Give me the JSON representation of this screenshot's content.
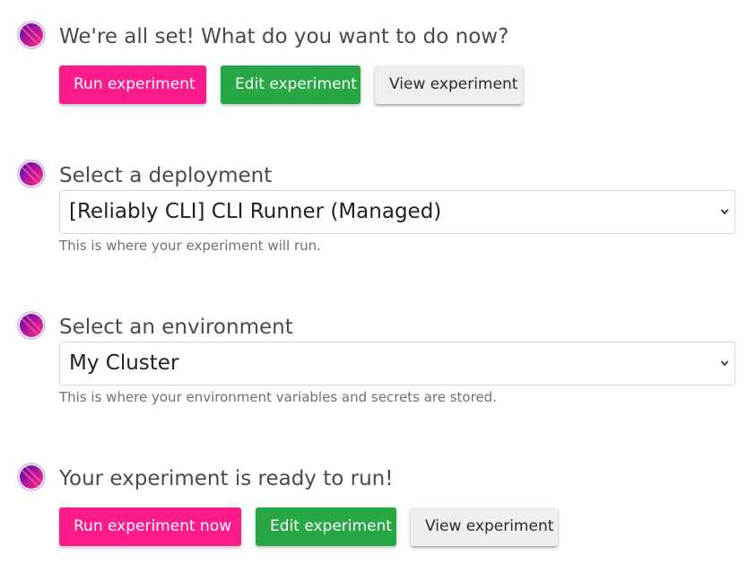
{
  "colors": {
    "accent_pink": "#fb1b8d",
    "accent_green": "#28a745",
    "neutral_button": "#efeff1"
  },
  "step1": {
    "avatar_icon": "reliably-logo-icon",
    "heading": "We're all set! What do you want to do now?",
    "run_label": "Run experiment",
    "edit_label": "Edit experiment",
    "view_label": "View experiment"
  },
  "step2": {
    "avatar_icon": "reliably-logo-icon",
    "heading": "Select a deployment",
    "selected": "[Reliably CLI] CLI Runner (Managed)",
    "help": "This is where your experiment will run."
  },
  "step3": {
    "avatar_icon": "reliably-logo-icon",
    "heading": "Select an environment",
    "selected": "My Cluster",
    "help": "This is where your environment variables and secrets are stored."
  },
  "step4": {
    "avatar_icon": "reliably-logo-icon",
    "heading": "Your experiment is ready to run!",
    "run_label": "Run experiment now",
    "edit_label": "Edit experiment",
    "view_label": "View experiment"
  }
}
